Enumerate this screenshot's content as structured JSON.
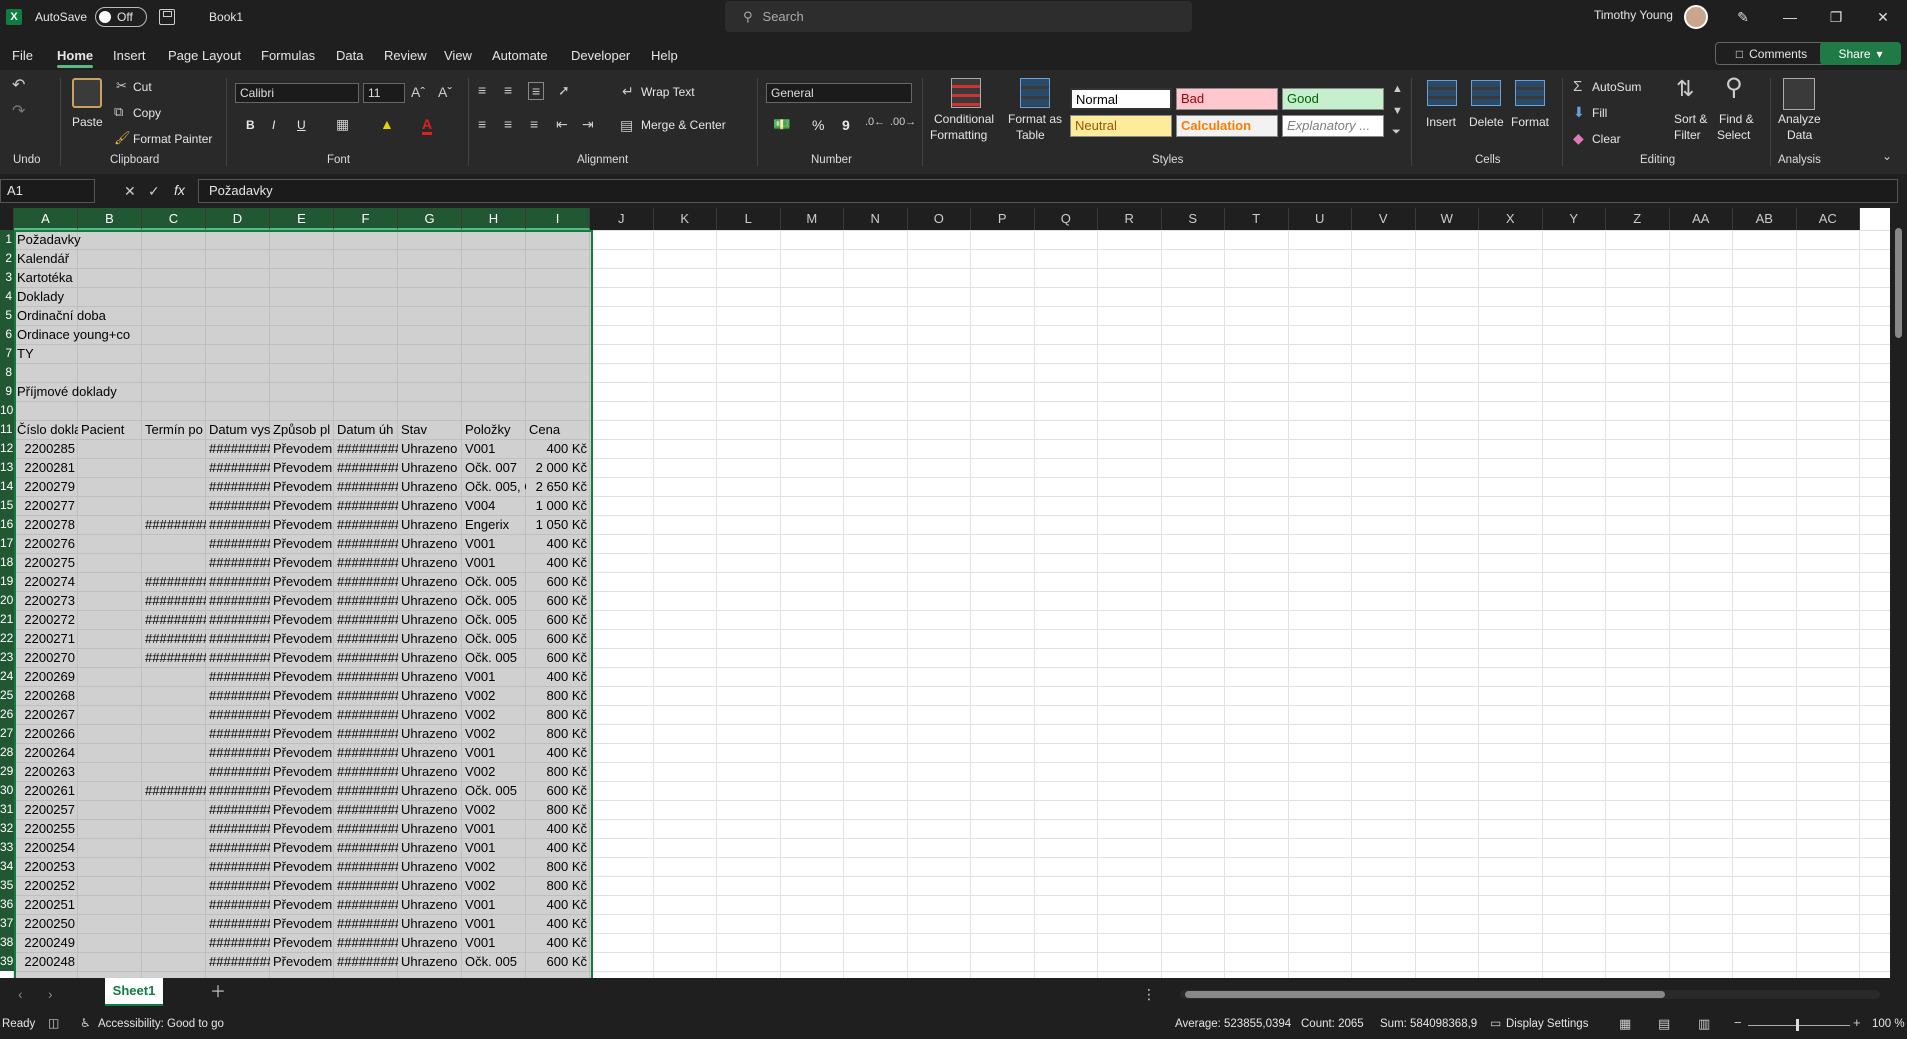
{
  "app": {
    "autosave_label": "AutoSave",
    "autosave_state": "Off",
    "doc_title": "Book1",
    "search_placeholder": "Search",
    "user_name": "Timothy Young",
    "logo_letter": "X"
  },
  "menu": [
    "File",
    "Home",
    "Insert",
    "Page Layout",
    "Formulas",
    "Data",
    "Review",
    "View",
    "Automate",
    "Developer",
    "Help"
  ],
  "top_buttons": {
    "comments": "Comments",
    "share": "Share"
  },
  "ribbon": {
    "undo_group": "Undo",
    "clipboard": {
      "paste": "Paste",
      "cut": "Cut",
      "copy": "Copy",
      "format_painter": "Format Painter",
      "label": "Clipboard"
    },
    "font": {
      "name": "Calibri",
      "size": "11",
      "label": "Font",
      "bold": "B",
      "italic": "I",
      "underline": "U",
      "font_color": "A"
    },
    "alignment": {
      "wrap_text": "Wrap Text",
      "merge_center": "Merge & Center",
      "label": "Alignment"
    },
    "number": {
      "format": "General",
      "label": "Number",
      "percent": "%",
      "comma": "9"
    },
    "styles": {
      "conditional_formatting": [
        "Conditional",
        "Formatting"
      ],
      "format_as_table": [
        "Format as",
        "Table"
      ],
      "cells": [
        {
          "label": "Normal",
          "bg": "#ffffff",
          "fg": "#000000"
        },
        {
          "label": "Bad",
          "bg": "#ffc7ce",
          "fg": "#9c0006"
        },
        {
          "label": "Good",
          "bg": "#c6efce",
          "fg": "#006100"
        },
        {
          "label": "Neutral",
          "bg": "#ffeb9c",
          "fg": "#9c5700"
        },
        {
          "label": "Calculation",
          "bg": "#f2f2f2",
          "fg": "#fa7d00"
        },
        {
          "label": "Explanatory ...",
          "bg": "#ffffff",
          "fg": "#7f7f7f"
        }
      ],
      "label": "Styles"
    },
    "cells": {
      "insert": "Insert",
      "delete": "Delete",
      "format": "Format",
      "label": "Cells"
    },
    "editing": {
      "autosum": "AutoSum",
      "fill": "Fill",
      "clear": "Clear",
      "sort_filter": [
        "Sort &",
        "Filter"
      ],
      "find_select": [
        "Find &",
        "Select"
      ],
      "label": "Editing"
    },
    "analysis": {
      "analyze": [
        "Analyze",
        "Data"
      ],
      "label": "Analysis"
    }
  },
  "formula_bar": {
    "name_box": "A1",
    "content": "Požadavky",
    "fx": "fx"
  },
  "columns": [
    "A",
    "B",
    "C",
    "D",
    "E",
    "F",
    "G",
    "H",
    "I",
    "J",
    "K",
    "L",
    "M",
    "N",
    "O",
    "P",
    "Q",
    "R",
    "S",
    "T",
    "U",
    "V",
    "W",
    "X",
    "Y",
    "Z",
    "AA",
    "AB",
    "AC"
  ],
  "rows_top": [
    {
      "n": "1",
      "a": "Požadavky"
    },
    {
      "n": "2",
      "a": "Kalendář"
    },
    {
      "n": "3",
      "a": "Kartotéka"
    },
    {
      "n": "4",
      "a": "Doklady"
    },
    {
      "n": "5",
      "a": "Ordinační doba"
    },
    {
      "n": "6",
      "a": "Ordinace young+co"
    },
    {
      "n": "7",
      "a": "TY"
    },
    {
      "n": "8",
      "a": ""
    },
    {
      "n": "9",
      "a": "Příjmové doklady"
    },
    {
      "n": "10",
      "a": ""
    }
  ],
  "header_row": {
    "n": "11",
    "cells": [
      "Číslo dokla",
      "Pacient",
      "Termín po",
      "Datum vys",
      "Způsob pl",
      "Datum úh",
      "Stav",
      "Položky",
      "Cena"
    ]
  },
  "data_rows": [
    {
      "n": "12",
      "id": "2200285",
      "c": "",
      "d": "#########",
      "e": "Převodem",
      "f": "#########",
      "g": "Uhrazeno",
      "h": "V001",
      "i": "400 Kč"
    },
    {
      "n": "13",
      "id": "2200281",
      "c": "",
      "d": "#########",
      "e": "Převodem",
      "f": "#########",
      "g": "Uhrazeno",
      "h": "Očk. 007",
      "i": "2 000 Kč"
    },
    {
      "n": "14",
      "id": "2200279",
      "c": "",
      "d": "#########",
      "e": "Převodem",
      "f": "#########",
      "g": "Uhrazeno",
      "h": "Očk. 005, O",
      "i": "2 650 Kč"
    },
    {
      "n": "15",
      "id": "2200277",
      "c": "",
      "d": "#########",
      "e": "Převodem",
      "f": "#########",
      "g": "Uhrazeno",
      "h": "V004",
      "i": "1 000 Kč"
    },
    {
      "n": "16",
      "id": "2200278",
      "c": "#########",
      "d": "#########",
      "e": "Převodem",
      "f": "#########",
      "g": "Uhrazeno",
      "h": "Engerix",
      "i": "1 050 Kč"
    },
    {
      "n": "17",
      "id": "2200276",
      "c": "",
      "d": "#########",
      "e": "Převodem",
      "f": "#########",
      "g": "Uhrazeno",
      "h": "V001",
      "i": "400 Kč"
    },
    {
      "n": "18",
      "id": "2200275",
      "c": "",
      "d": "#########",
      "e": "Převodem",
      "f": "#########",
      "g": "Uhrazeno",
      "h": "V001",
      "i": "400 Kč"
    },
    {
      "n": "19",
      "id": "2200274",
      "c": "#########",
      "d": "#########",
      "e": "Převodem",
      "f": "#########",
      "g": "Uhrazeno",
      "h": "Očk. 005",
      "i": "600 Kč"
    },
    {
      "n": "20",
      "id": "2200273",
      "c": "#########",
      "d": "#########",
      "e": "Převodem",
      "f": "#########",
      "g": "Uhrazeno",
      "h": "Očk. 005",
      "i": "600 Kč"
    },
    {
      "n": "21",
      "id": "2200272",
      "c": "#########",
      "d": "#########",
      "e": "Převodem",
      "f": "#########",
      "g": "Uhrazeno",
      "h": "Očk. 005",
      "i": "600 Kč"
    },
    {
      "n": "22",
      "id": "2200271",
      "c": "#########",
      "d": "#########",
      "e": "Převodem",
      "f": "#########",
      "g": "Uhrazeno",
      "h": "Očk. 005",
      "i": "600 Kč"
    },
    {
      "n": "23",
      "id": "2200270",
      "c": "#########",
      "d": "#########",
      "e": "Převodem",
      "f": "#########",
      "g": "Uhrazeno",
      "h": "Očk. 005",
      "i": "600 Kč"
    },
    {
      "n": "24",
      "id": "2200269",
      "c": "",
      "d": "#########",
      "e": "Převodem",
      "f": "#########",
      "g": "Uhrazeno",
      "h": "V001",
      "i": "400 Kč"
    },
    {
      "n": "25",
      "id": "2200268",
      "c": "",
      "d": "#########",
      "e": "Převodem",
      "f": "#########",
      "g": "Uhrazeno",
      "h": "V002",
      "i": "800 Kč"
    },
    {
      "n": "26",
      "id": "2200267",
      "c": "",
      "d": "#########",
      "e": "Převodem",
      "f": "#########",
      "g": "Uhrazeno",
      "h": "V002",
      "i": "800 Kč"
    },
    {
      "n": "27",
      "id": "2200266",
      "c": "",
      "d": "#########",
      "e": "Převodem",
      "f": "#########",
      "g": "Uhrazeno",
      "h": "V002",
      "i": "800 Kč"
    },
    {
      "n": "28",
      "id": "2200264",
      "c": "",
      "d": "#########",
      "e": "Převodem",
      "f": "#########",
      "g": "Uhrazeno",
      "h": "V001",
      "i": "400 Kč"
    },
    {
      "n": "29",
      "id": "2200263",
      "c": "",
      "d": "#########",
      "e": "Převodem",
      "f": "#########",
      "g": "Uhrazeno",
      "h": "V002",
      "i": "800 Kč"
    },
    {
      "n": "30",
      "id": "2200261",
      "c": "#########",
      "d": "#########",
      "e": "Převodem",
      "f": "#########",
      "g": "Uhrazeno",
      "h": "Očk. 005",
      "i": "600 Kč"
    },
    {
      "n": "31",
      "id": "2200257",
      "c": "",
      "d": "#########",
      "e": "Převodem",
      "f": "#########",
      "g": "Uhrazeno",
      "h": "V002",
      "i": "800 Kč"
    },
    {
      "n": "32",
      "id": "2200255",
      "c": "",
      "d": "#########",
      "e": "Převodem",
      "f": "#########",
      "g": "Uhrazeno",
      "h": "V001",
      "i": "400 Kč"
    },
    {
      "n": "33",
      "id": "2200254",
      "c": "",
      "d": "#########",
      "e": "Převodem",
      "f": "#########",
      "g": "Uhrazeno",
      "h": "V001",
      "i": "400 Kč"
    },
    {
      "n": "34",
      "id": "2200253",
      "c": "",
      "d": "#########",
      "e": "Převodem",
      "f": "#########",
      "g": "Uhrazeno",
      "h": "V002",
      "i": "800 Kč"
    },
    {
      "n": "35",
      "id": "2200252",
      "c": "",
      "d": "#########",
      "e": "Převodem",
      "f": "#########",
      "g": "Uhrazeno",
      "h": "V002",
      "i": "800 Kč"
    },
    {
      "n": "36",
      "id": "2200251",
      "c": "",
      "d": "#########",
      "e": "Převodem",
      "f": "#########",
      "g": "Uhrazeno",
      "h": "V001",
      "i": "400 Kč"
    },
    {
      "n": "37",
      "id": "2200250",
      "c": "",
      "d": "#########",
      "e": "Převodem",
      "f": "#########",
      "g": "Uhrazeno",
      "h": "V001",
      "i": "400 Kč"
    },
    {
      "n": "38",
      "id": "2200249",
      "c": "",
      "d": "#########",
      "e": "Převodem",
      "f": "#########",
      "g": "Uhrazeno",
      "h": "V001",
      "i": "400 Kč"
    },
    {
      "n": "39",
      "id": "2200248",
      "c": "",
      "d": "#########",
      "e": "Převodem",
      "f": "#########",
      "g": "Uhrazeno",
      "h": "Očk. 005",
      "i": "600 Kč"
    }
  ],
  "sheet_tabs": [
    "Sheet1"
  ],
  "status": {
    "ready": "Ready",
    "accessibility": "Accessibility: Good to go",
    "average": "Average: 523855,0394",
    "count": "Count: 2065",
    "sum": "Sum: 584098368,9",
    "display_settings": "Display Settings",
    "zoom": "100 %"
  },
  "colors": {
    "accent": "#107c41",
    "header_selected": "#215732",
    "share_button": "#1f7a45"
  }
}
